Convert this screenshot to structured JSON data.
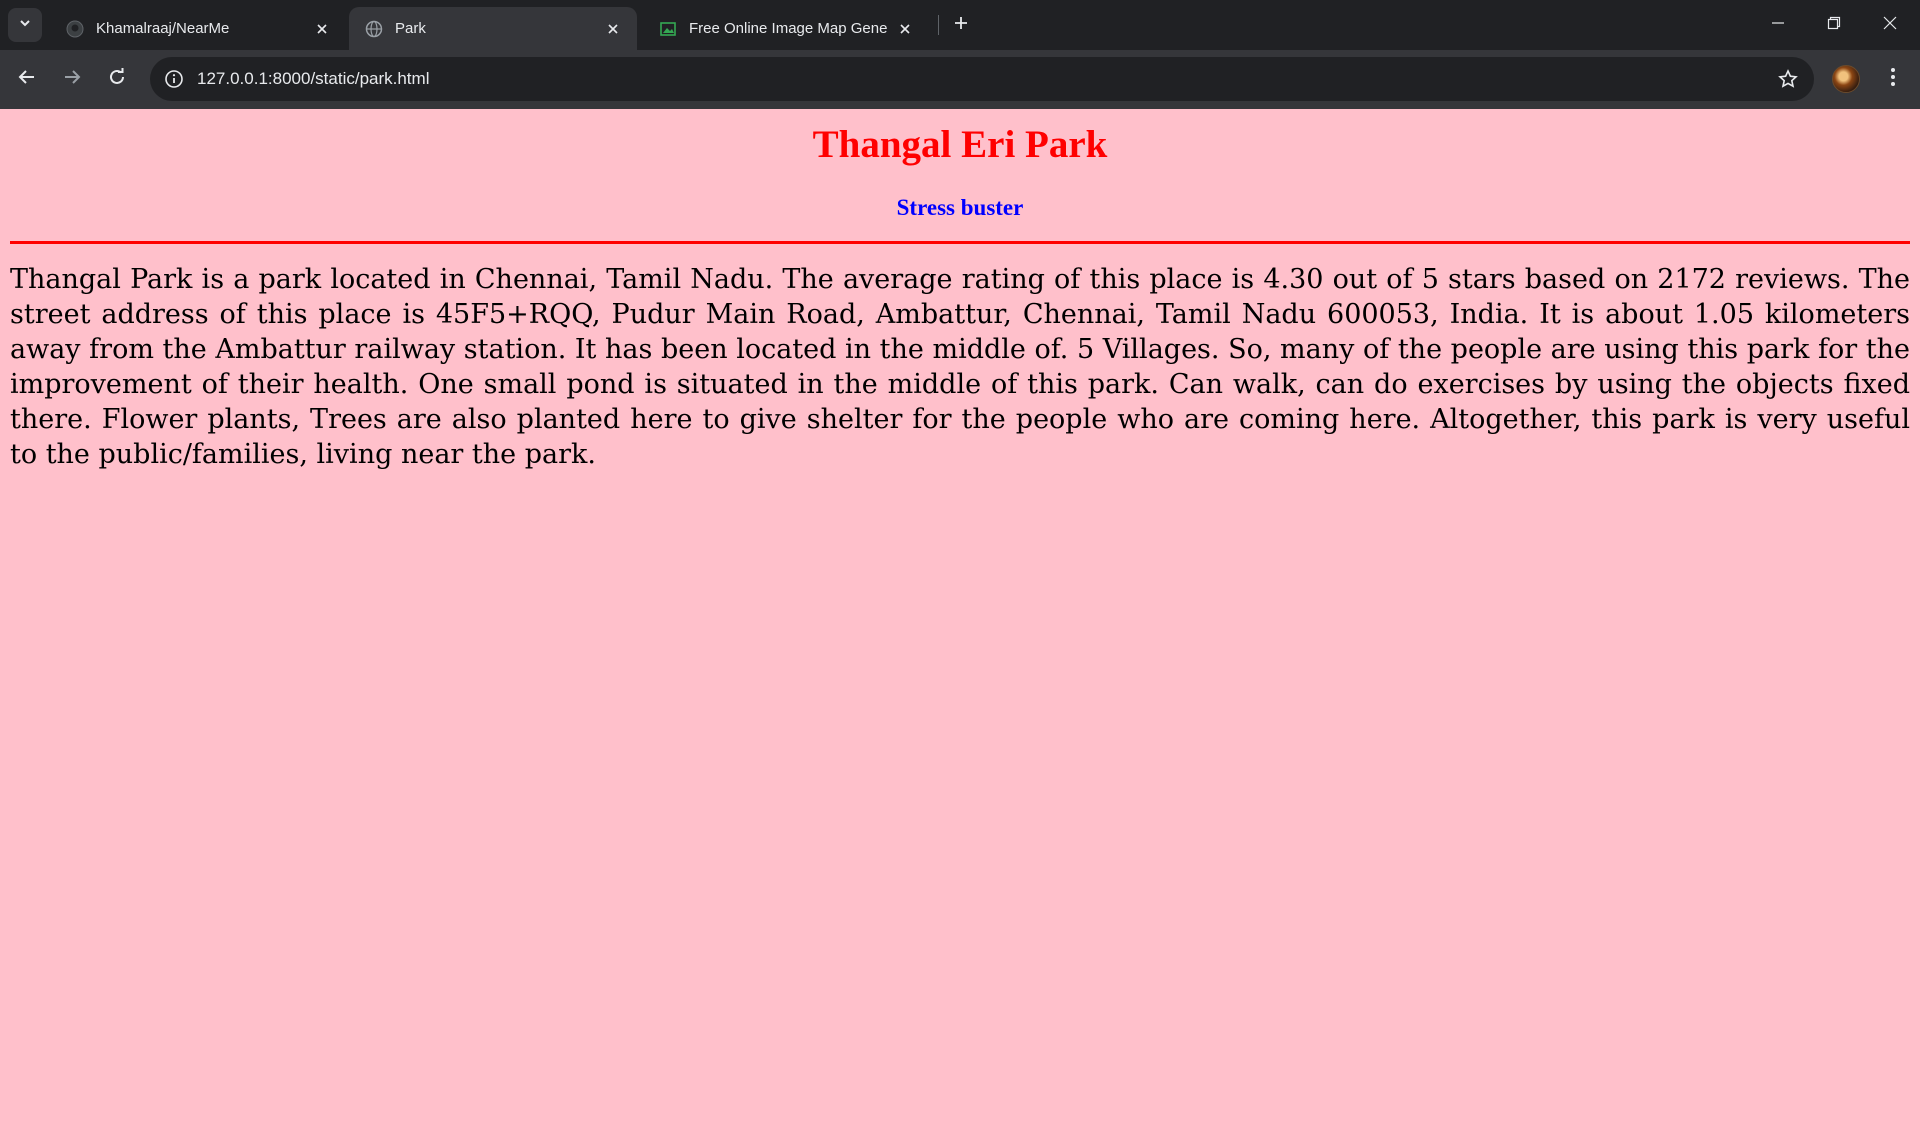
{
  "browser": {
    "tabs": [
      {
        "title": "Khamalraaj/NearMe",
        "favicon": "github-icon",
        "active": false
      },
      {
        "title": "Park",
        "favicon": "globe-icon",
        "active": true
      },
      {
        "title": "Free Online Image Map Generator",
        "favicon": "image-icon",
        "active": false
      }
    ],
    "address_url": "127.0.0.1:8000/static/park.html"
  },
  "page": {
    "background": "#ffc0cb",
    "heading": "Thangal Eri Park",
    "heading_color": "#ff0000",
    "subheading": "Stress buster",
    "subheading_color": "#0000ff",
    "body": "Thangal Park is a park located in Chennai, Tamil Nadu. The average rating of this place is 4.30 out of 5 stars based on 2172 reviews. The street address of this place is 45F5+RQQ, Pudur Main Road, Ambattur, Chennai, Tamil Nadu 600053, India. It is about 1.05 kilometers away from the Ambattur railway station. It has been located in the middle of. 5 Villages. So, many of the people are using this park for the improvement of their health. One small pond is situated in the middle of this park. Can walk, can do exercises by using the objects fixed there. Flower plants, Trees are also planted here to give shelter for the people who are coming here. Altogether, this park is very useful to the public/families, living near the park."
  }
}
